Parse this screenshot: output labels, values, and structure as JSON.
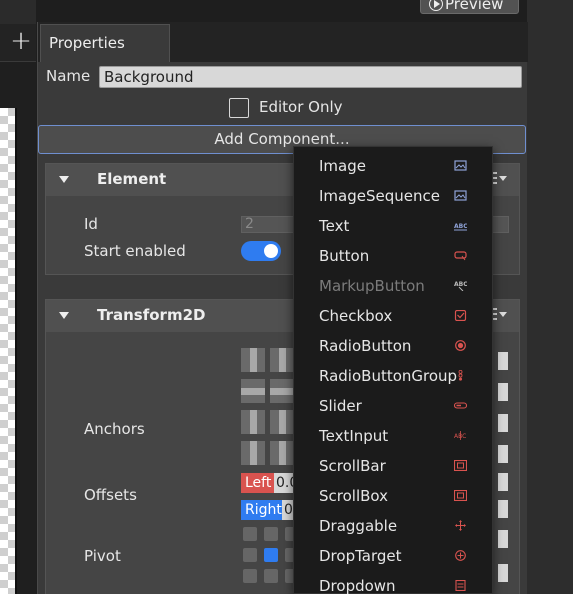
{
  "toolbar": {
    "preview_label": "Preview",
    "add_label": "+"
  },
  "panel": {
    "tab_label": "Properties",
    "name_label": "Name",
    "name_value": "Background",
    "editor_only_label": "Editor Only",
    "add_component_label": "Add Component..."
  },
  "element_section": {
    "title": "Element",
    "id_label": "Id",
    "id_value": "2",
    "start_enabled_label": "Start enabled",
    "start_enabled": true
  },
  "transform_section": {
    "title": "Transform2D",
    "anchors_label": "Anchors",
    "offsets_label": "Offsets",
    "offset_left_tag": "Left",
    "offset_left_value": "0.0",
    "offset_right_tag": "Right",
    "offset_right_value": "0.",
    "pivot_label": "Pivot"
  },
  "component_menu": {
    "items": [
      {
        "label": "Image",
        "icon": "image-icon",
        "enabled": true
      },
      {
        "label": "ImageSequence",
        "icon": "image-sequence-icon",
        "enabled": true
      },
      {
        "label": "Text",
        "icon": "text-icon",
        "enabled": true
      },
      {
        "label": "Button",
        "icon": "button-icon",
        "enabled": true
      },
      {
        "label": "MarkupButton",
        "icon": "markup-button-icon",
        "enabled": false
      },
      {
        "label": "Checkbox",
        "icon": "checkbox-icon",
        "enabled": true
      },
      {
        "label": "RadioButton",
        "icon": "radio-button-icon",
        "enabled": true
      },
      {
        "label": "RadioButtonGroup",
        "icon": "radio-button-group-icon",
        "enabled": true
      },
      {
        "label": "Slider",
        "icon": "slider-icon",
        "enabled": true
      },
      {
        "label": "TextInput",
        "icon": "text-input-icon",
        "enabled": true
      },
      {
        "label": "ScrollBar",
        "icon": "scrollbar-icon",
        "enabled": true
      },
      {
        "label": "ScrollBox",
        "icon": "scrollbox-icon",
        "enabled": true
      },
      {
        "label": "Draggable",
        "icon": "draggable-icon",
        "enabled": true
      },
      {
        "label": "DropTarget",
        "icon": "drop-target-icon",
        "enabled": true
      },
      {
        "label": "Dropdown",
        "icon": "dropdown-icon",
        "enabled": true
      }
    ]
  },
  "colors": {
    "accent_blue": "#2f7cf0",
    "left_tag_red": "#d9534f",
    "icon_blue": "#8fa3d8",
    "icon_red": "#d9534f",
    "menu_bg": "#1b1b1b",
    "panel_bg": "#3a3a3a"
  }
}
